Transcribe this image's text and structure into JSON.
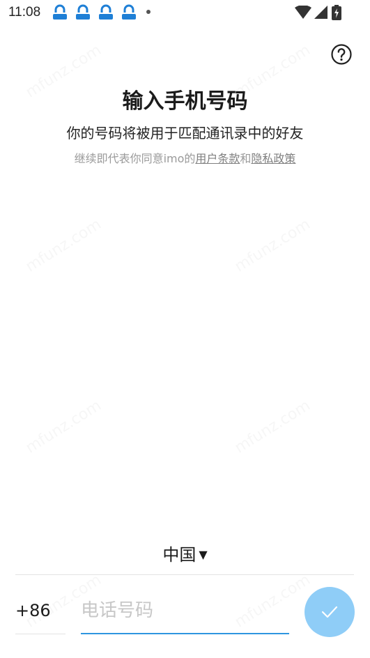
{
  "status_bar": {
    "time": "11:08",
    "notification_icons": [
      "app-notification-icon",
      "app-notification-icon",
      "app-notification-icon",
      "app-notification-icon"
    ],
    "system_icons": [
      "wifi-icon",
      "signal-icon",
      "battery-charging-icon"
    ]
  },
  "header": {
    "help_icon": "help-circle-icon"
  },
  "main": {
    "title": "输入手机号码",
    "subtitle": "你的号码将被用于匹配通讯录中的好友",
    "terms_prefix": "继续即代表你同意imo的",
    "terms_link": "用户条款",
    "terms_and": "和",
    "privacy_link": "隐私政策"
  },
  "watermark": "mfunz.com",
  "form": {
    "country": "中国",
    "country_code": "+86",
    "phone_placeholder": "电话号码",
    "phone_value": ""
  },
  "colors": {
    "accent": "#2e95e0",
    "next_button": "#8fcdf7",
    "notification_icon": "#1e7fd6"
  }
}
